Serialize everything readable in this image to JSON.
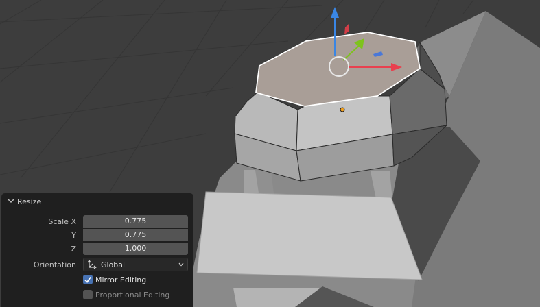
{
  "panel": {
    "title": "Resize",
    "scale_x_label": "Scale X",
    "scale_x_value": "0.775",
    "y_label": "Y",
    "y_value": "0.775",
    "z_label": "Z",
    "z_value": "1.000",
    "orientation_label": "Orientation",
    "orientation_value": "Global",
    "mirror_label": "Mirror Editing",
    "mirror_checked": true,
    "proportional_label": "Proportional Editing",
    "proportional_checked": false
  },
  "viewport": {
    "gizmo_axes": [
      "z-axis-arrow",
      "x-axis-arrow",
      "y-axis-arrow"
    ],
    "colors": {
      "background": "#3d3d3d",
      "x_axis": "#e8404f",
      "y_axis": "#7ec31c",
      "z_axis": "#3a86e4",
      "selected_face": "#a99e97",
      "checkbox_active": "#4772b3"
    }
  }
}
